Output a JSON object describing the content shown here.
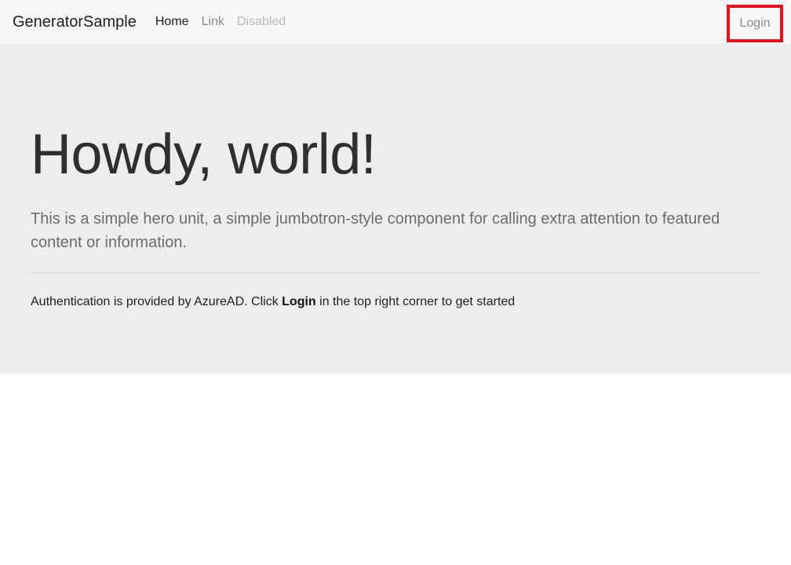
{
  "navbar": {
    "brand": "GeneratorSample",
    "links": [
      {
        "label": "Home",
        "state": "active"
      },
      {
        "label": "Link",
        "state": "normal"
      },
      {
        "label": "Disabled",
        "state": "disabled"
      }
    ],
    "login_label": "Login"
  },
  "hero": {
    "heading": "Howdy, world!",
    "lead": "This is a simple hero unit, a simple jumbotron-style component for calling extra attention to featured content or information.",
    "auth_prefix": "Authentication is provided by AzureAD. Click ",
    "auth_emphasis": "Login",
    "auth_suffix": " in the top right corner to get started"
  },
  "colors": {
    "navbar_bg": "#f7f7f7",
    "jumbotron_bg": "#ecedef",
    "highlight_border": "#e8111b"
  }
}
